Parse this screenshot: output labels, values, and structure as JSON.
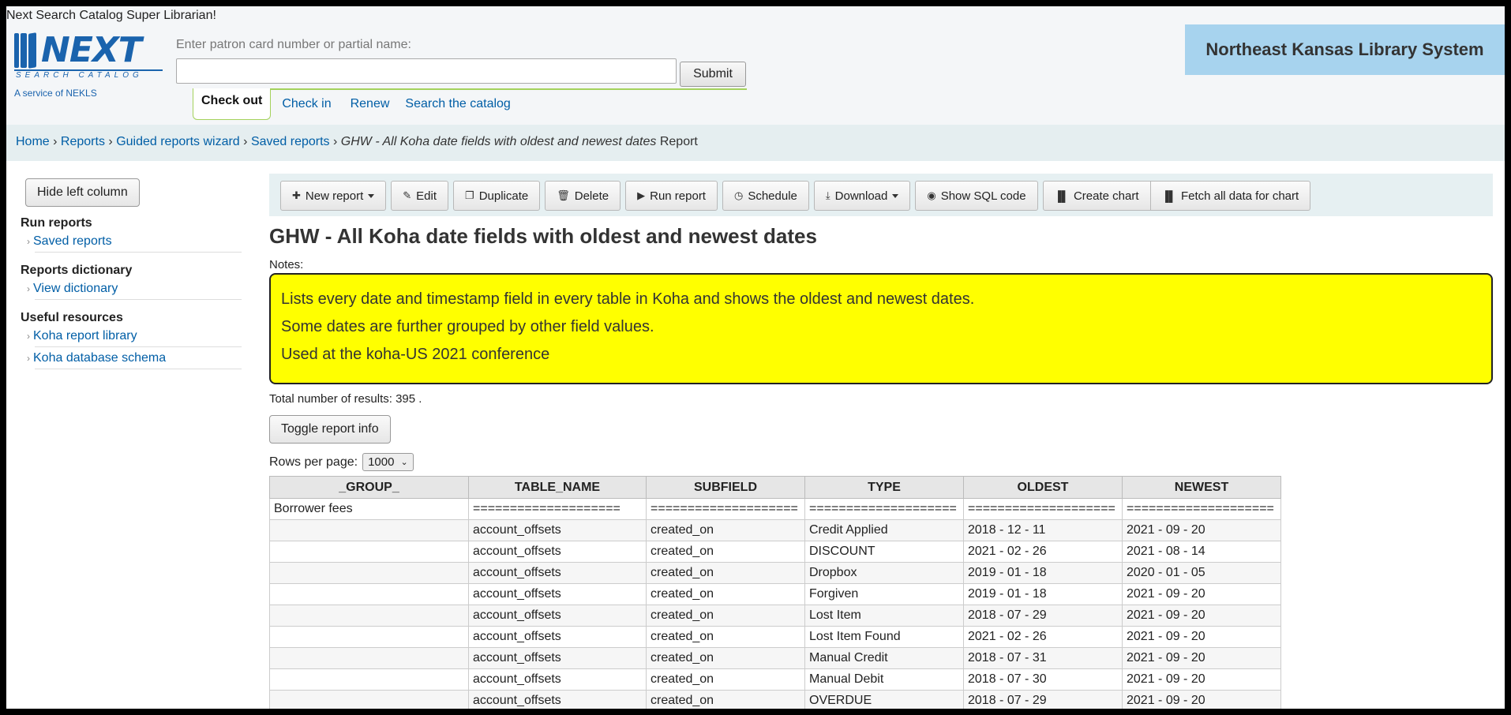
{
  "header": {
    "login_line": "Next Search Catalog Super Librarian!",
    "logo_word": "NEXT",
    "logo_sub": "SEARCH CATALOG",
    "logo_service": "A service of NEKLS",
    "patron_label": "Enter patron card number or partial name:",
    "patron_value": "",
    "submit_label": "Submit",
    "system_name": "Northeast Kansas Library System",
    "circ_tabs": [
      "Check out",
      "Check in",
      "Renew",
      "Search the catalog"
    ]
  },
  "breadcrumb": {
    "items": [
      "Home",
      "Reports",
      "Guided reports wizard",
      "Saved reports"
    ],
    "current_italic": "GHW - All Koha date fields with oldest and newest dates",
    "current_suffix": " Report",
    "separator": "›"
  },
  "left": {
    "hide_label": "Hide left column",
    "sections": [
      {
        "heading": "Run reports",
        "items": [
          "Saved reports"
        ]
      },
      {
        "heading": "Reports dictionary",
        "items": [
          "View dictionary"
        ]
      },
      {
        "heading": "Useful resources",
        "items": [
          "Koha report library",
          "Koha database schema"
        ]
      }
    ]
  },
  "toolbar": {
    "new_report": "New report",
    "edit": "Edit",
    "duplicate": "Duplicate",
    "delete": "Delete",
    "run_report": "Run report",
    "schedule": "Schedule",
    "download": "Download",
    "show_sql": "Show SQL code",
    "create_chart": "Create chart",
    "fetch_all": "Fetch all data for chart"
  },
  "report": {
    "title": "GHW - All Koha date fields with oldest and newest dates",
    "notes_label": "Notes:",
    "notes": [
      "Lists every date and timestamp field in every table in Koha and shows the oldest and newest dates.",
      "Some dates are further grouped by other field values.",
      "Used at the koha-US 2021 conference"
    ],
    "total_label": "Total number of results:",
    "total_value": "395",
    "total_suffix": ".",
    "toggle_label": "Toggle report info",
    "rows_label": "Rows per page:",
    "rows_value": "1000"
  },
  "table": {
    "columns": [
      "_GROUP_",
      "TABLE_NAME",
      "SUBFIELD",
      "TYPE",
      "OLDEST",
      "NEWEST"
    ],
    "rows": [
      [
        "Borrower fees",
        "====================",
        "====================",
        "====================",
        "====================",
        "===================="
      ],
      [
        "",
        "account_offsets",
        "created_on",
        "Credit Applied",
        "2018 - 12 - 11",
        "2021 - 09 - 20"
      ],
      [
        "",
        "account_offsets",
        "created_on",
        "DISCOUNT",
        "2021 - 02 - 26",
        "2021 - 08 - 14"
      ],
      [
        "",
        "account_offsets",
        "created_on",
        "Dropbox",
        "2019 - 01 - 18",
        "2020 - 01 - 05"
      ],
      [
        "",
        "account_offsets",
        "created_on",
        "Forgiven",
        "2019 - 01 - 18",
        "2021 - 09 - 20"
      ],
      [
        "",
        "account_offsets",
        "created_on",
        "Lost Item",
        "2018 - 07 - 29",
        "2021 - 09 - 20"
      ],
      [
        "",
        "account_offsets",
        "created_on",
        "Lost Item Found",
        "2021 - 02 - 26",
        "2021 - 09 - 20"
      ],
      [
        "",
        "account_offsets",
        "created_on",
        "Manual Credit",
        "2018 - 07 - 31",
        "2021 - 09 - 20"
      ],
      [
        "",
        "account_offsets",
        "created_on",
        "Manual Debit",
        "2018 - 07 - 30",
        "2021 - 09 - 20"
      ],
      [
        "",
        "account_offsets",
        "created_on",
        "OVERDUE",
        "2018 - 07 - 29",
        "2021 - 09 - 20"
      ]
    ]
  },
  "colors": {
    "link": "#005ea6",
    "notes_bg": "#ffff00",
    "system_box": "#a7d3ee",
    "breadcrumb_bg": "#e5eef0"
  }
}
